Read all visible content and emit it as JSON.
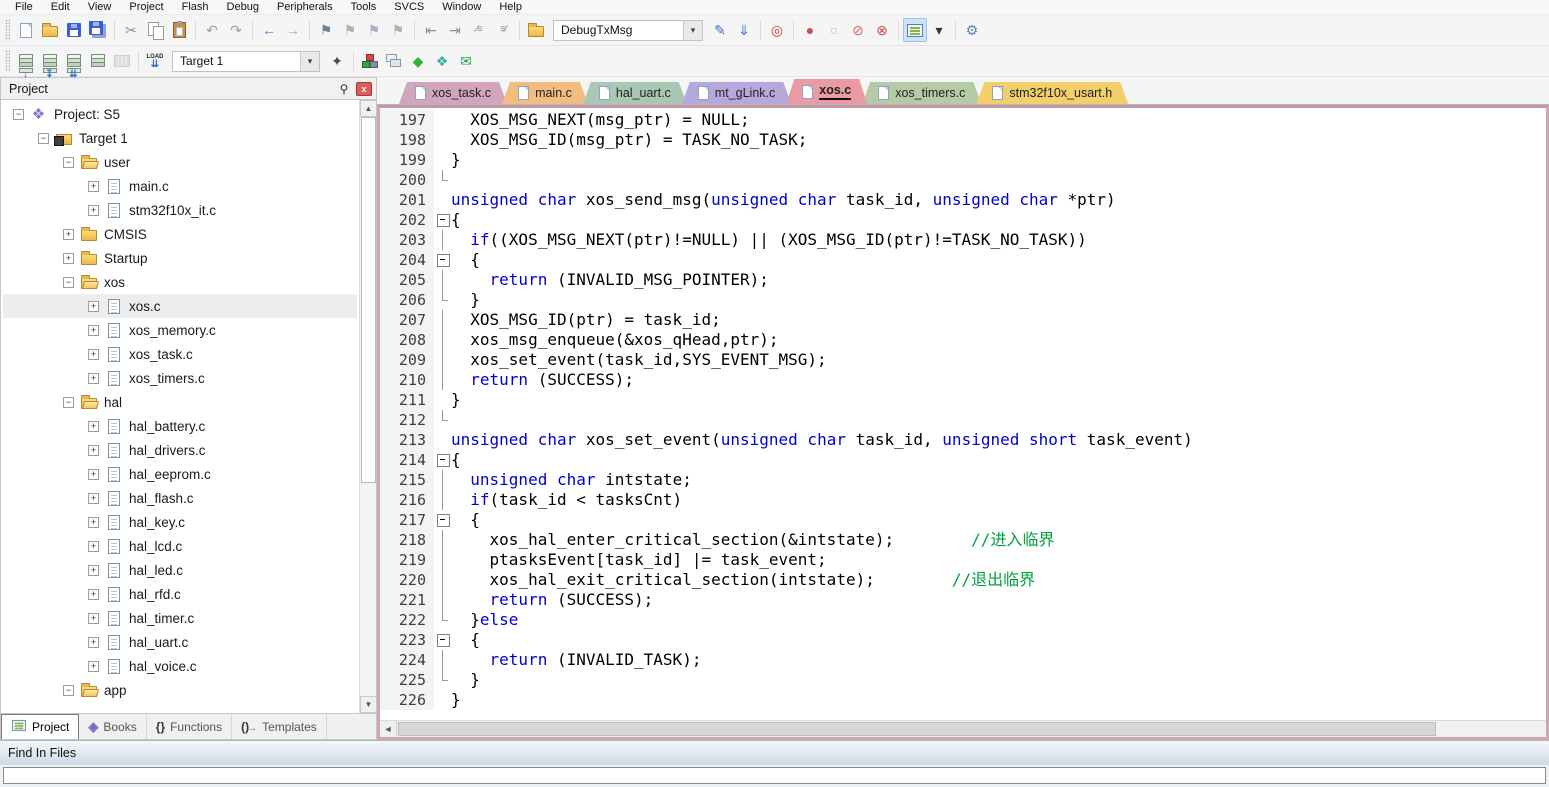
{
  "menu": {
    "items": [
      "File",
      "Edit",
      "View",
      "Project",
      "Flash",
      "Debug",
      "Peripherals",
      "Tools",
      "SVCS",
      "Window",
      "Help"
    ]
  },
  "toolbar1": {
    "items": [
      {
        "type": "grip"
      },
      {
        "name": "new-file-icon",
        "kind": "page"
      },
      {
        "name": "open-file-icon",
        "kind": "folder"
      },
      {
        "name": "save-icon",
        "kind": "floppy"
      },
      {
        "name": "save-all-icon",
        "kind": "floppy2"
      },
      {
        "type": "sep"
      },
      {
        "name": "cut-icon",
        "glyph": "✂",
        "color": "#8f8f8f"
      },
      {
        "name": "copy-icon",
        "kind": "copy"
      },
      {
        "name": "paste-icon",
        "kind": "paste"
      },
      {
        "type": "sep"
      },
      {
        "name": "undo-icon",
        "glyph": "↶",
        "color": "#9c9c9c"
      },
      {
        "name": "redo-icon",
        "glyph": "↷",
        "color": "#9c9c9c"
      },
      {
        "type": "sep"
      },
      {
        "name": "navigate-back-icon",
        "glyph": "←",
        "color": "#4f7cc9"
      },
      {
        "name": "navigate-forward-icon",
        "glyph": "→",
        "color": "#a8a8a8"
      },
      {
        "type": "sep"
      },
      {
        "name": "insert-bookmark-icon",
        "glyph": "⚑",
        "color": "#6f7f94"
      },
      {
        "name": "prev-bookmark-icon",
        "glyph": "⚑",
        "color": "#aab3c0"
      },
      {
        "name": "next-bookmark-icon",
        "glyph": "⚑",
        "color": "#aab3c0"
      },
      {
        "name": "clear-bookmarks-icon",
        "glyph": "⚑",
        "color": "#aab3c0"
      },
      {
        "type": "sep"
      },
      {
        "name": "unindent-icon",
        "glyph": "⇤",
        "color": "#8f8f8f"
      },
      {
        "name": "indent-icon",
        "glyph": "⇥",
        "color": "#8f8f8f"
      },
      {
        "name": "comment-icon",
        "glyph": "∕≡",
        "color": "#8f8f8f"
      },
      {
        "name": "uncomment-icon",
        "glyph": "≡∕",
        "color": "#8f8f8f"
      },
      {
        "type": "sep"
      },
      {
        "name": "find-in-files-icon",
        "kind": "folder"
      },
      {
        "type": "combo",
        "name": "debug-config-combo",
        "value": "DebugTxMsg",
        "width": 150
      },
      {
        "name": "lookup-word-icon",
        "glyph": "✎",
        "color": "#3f6fc4"
      },
      {
        "name": "goto-reference-icon",
        "glyph": "⇓",
        "color": "#3f6fc4"
      },
      {
        "type": "sep"
      },
      {
        "name": "find-icon",
        "glyph": "◎",
        "color": "#c43b3b"
      },
      {
        "type": "sep"
      },
      {
        "name": "breakpoint-icon",
        "glyph": "●",
        "color": "#cf4a4a"
      },
      {
        "name": "breakpoint-disabled-icon",
        "glyph": "○",
        "color": "#b9b9b9"
      },
      {
        "name": "disable-all-breakpoints-icon",
        "glyph": "⊘",
        "color": "#d06a6a"
      },
      {
        "name": "kill-all-breakpoints-icon",
        "glyph": "⊗",
        "color": "#cf4a4a"
      },
      {
        "type": "sep"
      },
      {
        "name": "project-window-icon",
        "kind": "list",
        "active": true
      },
      {
        "name": "window-dropdown-icon",
        "glyph": "▾",
        "color": "#333333"
      },
      {
        "type": "sep"
      },
      {
        "name": "configuration-icon",
        "glyph": "⚙",
        "color": "#5b7fb4"
      }
    ]
  },
  "toolbar2": {
    "items": [
      {
        "type": "grip"
      },
      {
        "name": "translate-icon",
        "kind": "stack",
        "ov": "↓",
        "ovc": "#2f6fd0"
      },
      {
        "name": "build-icon",
        "kind": "stack",
        "ov": "↧",
        "ovc": "#2f6fd0"
      },
      {
        "name": "rebuild-icon",
        "kind": "stack",
        "ov": "⇊",
        "ovc": "#2f6fd0"
      },
      {
        "name": "batch-build-icon",
        "kind": "stack"
      },
      {
        "name": "stop-build-icon",
        "kind": "stop",
        "disabled": true
      },
      {
        "type": "sep"
      },
      {
        "name": "download-icon",
        "kind": "load",
        "load_label": "LOAD",
        "load_arrows": "⇊"
      },
      {
        "type": "combo",
        "name": "target-select-combo",
        "value": "Target 1",
        "width": 148
      },
      {
        "name": "target-options-icon",
        "glyph": "✦",
        "color": "#4a4a4a"
      },
      {
        "type": "sep"
      },
      {
        "name": "manage-components-icon",
        "kind": "components"
      },
      {
        "name": "file-extensions-icon",
        "kind": "rects"
      },
      {
        "name": "software-packs-icon",
        "glyph": "◆",
        "color": "#2db52d"
      },
      {
        "name": "pack-installer-icon",
        "glyph": "❖",
        "color": "#35b0a8"
      },
      {
        "name": "runtime-environment-icon",
        "glyph": "✉",
        "color": "#2d9e55"
      }
    ]
  },
  "project_panel": {
    "title": "Project",
    "close_label": "x",
    "tabs": [
      {
        "label": "Project",
        "icon": "list",
        "active": true
      },
      {
        "label": "Books",
        "icon": "book"
      },
      {
        "label": "Functions",
        "icon": "braces"
      },
      {
        "label": "Templates",
        "icon": "parens"
      }
    ],
    "tree": [
      {
        "label": "Project: S5",
        "level": 0,
        "expander": "minus",
        "icon": "project"
      },
      {
        "label": "Target 1",
        "level": 1,
        "expander": "minus",
        "icon": "target"
      },
      {
        "label": "user",
        "level": 2,
        "expander": "minus",
        "icon": "folder-open"
      },
      {
        "label": "main.c",
        "level": 3,
        "expander": "plus",
        "icon": "file"
      },
      {
        "label": "stm32f10x_it.c",
        "level": 3,
        "expander": "plus",
        "icon": "file"
      },
      {
        "label": "CMSIS",
        "level": 2,
        "expander": "plus",
        "icon": "folder"
      },
      {
        "label": "Startup",
        "level": 2,
        "expander": "plus",
        "icon": "folder"
      },
      {
        "label": "xos",
        "level": 2,
        "expander": "minus",
        "icon": "folder-open"
      },
      {
        "label": "xos.c",
        "level": 3,
        "expander": "plus",
        "icon": "file",
        "selected": true
      },
      {
        "label": "xos_memory.c",
        "level": 3,
        "expander": "plus",
        "icon": "file"
      },
      {
        "label": "xos_task.c",
        "level": 3,
        "expander": "plus",
        "icon": "file"
      },
      {
        "label": "xos_timers.c",
        "level": 3,
        "expander": "plus",
        "icon": "file"
      },
      {
        "label": "hal",
        "level": 2,
        "expander": "minus",
        "icon": "folder-open"
      },
      {
        "label": "hal_battery.c",
        "level": 3,
        "expander": "plus",
        "icon": "file"
      },
      {
        "label": "hal_drivers.c",
        "level": 3,
        "expander": "plus",
        "icon": "file"
      },
      {
        "label": "hal_eeprom.c",
        "level": 3,
        "expander": "plus",
        "icon": "file"
      },
      {
        "label": "hal_flash.c",
        "level": 3,
        "expander": "plus",
        "icon": "file"
      },
      {
        "label": "hal_key.c",
        "level": 3,
        "expander": "plus",
        "icon": "file"
      },
      {
        "label": "hal_lcd.c",
        "level": 3,
        "expander": "plus",
        "icon": "file"
      },
      {
        "label": "hal_led.c",
        "level": 3,
        "expander": "plus",
        "icon": "file"
      },
      {
        "label": "hal_rfd.c",
        "level": 3,
        "expander": "plus",
        "icon": "file"
      },
      {
        "label": "hal_timer.c",
        "level": 3,
        "expander": "plus",
        "icon": "file"
      },
      {
        "label": "hal_uart.c",
        "level": 3,
        "expander": "plus",
        "icon": "file"
      },
      {
        "label": "hal_voice.c",
        "level": 3,
        "expander": "plus",
        "icon": "file"
      },
      {
        "label": "app",
        "level": 2,
        "expander": "minus",
        "icon": "folder-open"
      }
    ]
  },
  "editor": {
    "tabs": [
      {
        "label": "xos_task.c",
        "color": "#d3a5bd"
      },
      {
        "label": "main.c",
        "color": "#f3bc80"
      },
      {
        "label": "hal_uart.c",
        "color": "#a9c7b2"
      },
      {
        "label": "mt_gLink.c",
        "color": "#b7a8dc"
      },
      {
        "label": "xos.c",
        "color": "#e99aa4",
        "active": true
      },
      {
        "label": "xos_timers.c",
        "color": "#b4cba5"
      },
      {
        "label": "stm32f10x_usart.h",
        "color": "#f3cf6b"
      }
    ],
    "colors": {
      "keyword": "#0000cd",
      "comment": "#00a040",
      "text": "#000000",
      "frame": "#d0a7b0"
    },
    "code": {
      "lines": [
        {
          "n": 197,
          "fold": "",
          "segs": [
            [
              "  XOS_MSG_NEXT(msg_ptr) = NULL;",
              "c"
            ]
          ]
        },
        {
          "n": 198,
          "fold": "",
          "segs": [
            [
              "  XOS_MSG_ID(msg_ptr) = TASK_NO_TASK;",
              "c"
            ]
          ]
        },
        {
          "n": 199,
          "fold": "",
          "segs": [
            [
              "}",
              "c"
            ]
          ]
        },
        {
          "n": 200,
          "fold": "tick",
          "segs": []
        },
        {
          "n": 201,
          "fold": "",
          "segs": [
            [
              "unsigned char",
              "k"
            ],
            [
              " xos_send_msg(",
              "c"
            ],
            [
              "unsigned char",
              "k"
            ],
            [
              " task_id, ",
              "c"
            ],
            [
              "unsigned char",
              "k"
            ],
            [
              " *ptr)",
              "c"
            ]
          ]
        },
        {
          "n": 202,
          "fold": "box",
          "segs": [
            [
              "{",
              "c"
            ]
          ]
        },
        {
          "n": 203,
          "fold": "vline",
          "segs": [
            [
              "  ",
              "c"
            ],
            [
              "if",
              "k"
            ],
            [
              "((XOS_MSG_NEXT(ptr)!=NULL) || (XOS_MSG_ID(ptr)!=TASK_NO_TASK))",
              "c"
            ]
          ]
        },
        {
          "n": 204,
          "fold": "box",
          "segs": [
            [
              "  {",
              "c"
            ]
          ]
        },
        {
          "n": 205,
          "fold": "vline",
          "segs": [
            [
              "    ",
              "c"
            ],
            [
              "return",
              "k"
            ],
            [
              " (INVALID_MSG_POINTER);",
              "c"
            ]
          ]
        },
        {
          "n": 206,
          "fold": "tick",
          "segs": [
            [
              "  }",
              "c"
            ]
          ]
        },
        {
          "n": 207,
          "fold": "vline",
          "segs": [
            [
              "  XOS_MSG_ID(ptr) = task_id;",
              "c"
            ]
          ]
        },
        {
          "n": 208,
          "fold": "vline",
          "segs": [
            [
              "  xos_msg_enqueue(&xos_qHead,ptr);",
              "c"
            ]
          ]
        },
        {
          "n": 209,
          "fold": "vline",
          "segs": [
            [
              "  xos_set_event(task_id,SYS_EVENT_MSG);",
              "c"
            ]
          ]
        },
        {
          "n": 210,
          "fold": "vline",
          "segs": [
            [
              "  ",
              "c"
            ],
            [
              "return",
              "k"
            ],
            [
              " (SUCCESS);",
              "c"
            ]
          ]
        },
        {
          "n": 211,
          "fold": "",
          "segs": [
            [
              "}",
              "c"
            ]
          ]
        },
        {
          "n": 212,
          "fold": "tick",
          "segs": []
        },
        {
          "n": 213,
          "fold": "",
          "segs": [
            [
              "unsigned char",
              "k"
            ],
            [
              " xos_set_event(",
              "c"
            ],
            [
              "unsigned char",
              "k"
            ],
            [
              " task_id, ",
              "c"
            ],
            [
              "unsigned short",
              "k"
            ],
            [
              " task_event)",
              "c"
            ]
          ]
        },
        {
          "n": 214,
          "fold": "box",
          "segs": [
            [
              "{",
              "c"
            ]
          ]
        },
        {
          "n": 215,
          "fold": "vline",
          "segs": [
            [
              "  ",
              "c"
            ],
            [
              "unsigned char",
              "k"
            ],
            [
              " intstate;",
              "c"
            ]
          ]
        },
        {
          "n": 216,
          "fold": "vline",
          "segs": [
            [
              "  ",
              "c"
            ],
            [
              "if",
              "k"
            ],
            [
              "(task_id < tasksCnt)",
              "c"
            ]
          ]
        },
        {
          "n": 217,
          "fold": "box",
          "segs": [
            [
              "  {",
              "c"
            ]
          ]
        },
        {
          "n": 218,
          "fold": "vline",
          "segs": [
            [
              "    xos_hal_enter_critical_section(&intstate);        ",
              "c"
            ],
            [
              "//进入临界",
              "m"
            ]
          ]
        },
        {
          "n": 219,
          "fold": "vline",
          "segs": [
            [
              "    ptasksEvent[task_id] |= task_event;",
              "c"
            ]
          ]
        },
        {
          "n": 220,
          "fold": "vline",
          "segs": [
            [
              "    xos_hal_exit_critical_section(intstate);        ",
              "c"
            ],
            [
              "//退出临界",
              "m"
            ]
          ]
        },
        {
          "n": 221,
          "fold": "vline",
          "segs": [
            [
              "    ",
              "c"
            ],
            [
              "return",
              "k"
            ],
            [
              " (SUCCESS);",
              "c"
            ]
          ]
        },
        {
          "n": 222,
          "fold": "tick",
          "segs": [
            [
              "  }",
              "c"
            ],
            [
              "else",
              "k"
            ]
          ]
        },
        {
          "n": 223,
          "fold": "box",
          "segs": [
            [
              "  {",
              "c"
            ]
          ]
        },
        {
          "n": 224,
          "fold": "vline",
          "segs": [
            [
              "    ",
              "c"
            ],
            [
              "return",
              "k"
            ],
            [
              " (INVALID_TASK);",
              "c"
            ]
          ]
        },
        {
          "n": 225,
          "fold": "tick",
          "segs": [
            [
              "  }",
              "c"
            ]
          ]
        },
        {
          "n": 226,
          "fold": "",
          "segs": [
            [
              "}",
              "c"
            ]
          ]
        }
      ]
    }
  },
  "find_panel": {
    "title": "Find In Files"
  }
}
